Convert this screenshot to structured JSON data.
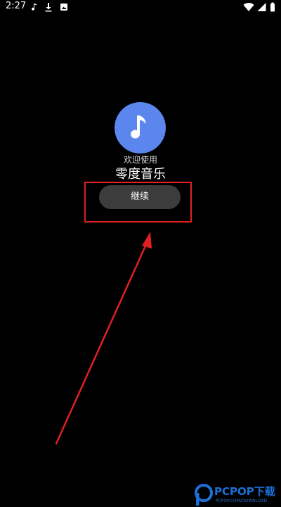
{
  "status_bar": {
    "time": "2:27",
    "icons": [
      "music-note-icon",
      "download-icon",
      "image-notification-icon",
      "wifi-icon",
      "signal-icon",
      "battery-icon"
    ]
  },
  "app": {
    "icon": "music-note-icon",
    "icon_color": "#5b86ee",
    "welcome_text": "欢迎使用",
    "name": "零度音乐"
  },
  "continue_button": {
    "label": "继续"
  },
  "annotation": {
    "color": "#e02020"
  },
  "watermark": {
    "text": "PCPOP下载",
    "subtext": "PCPOP.COM/DOWNLOAD"
  }
}
